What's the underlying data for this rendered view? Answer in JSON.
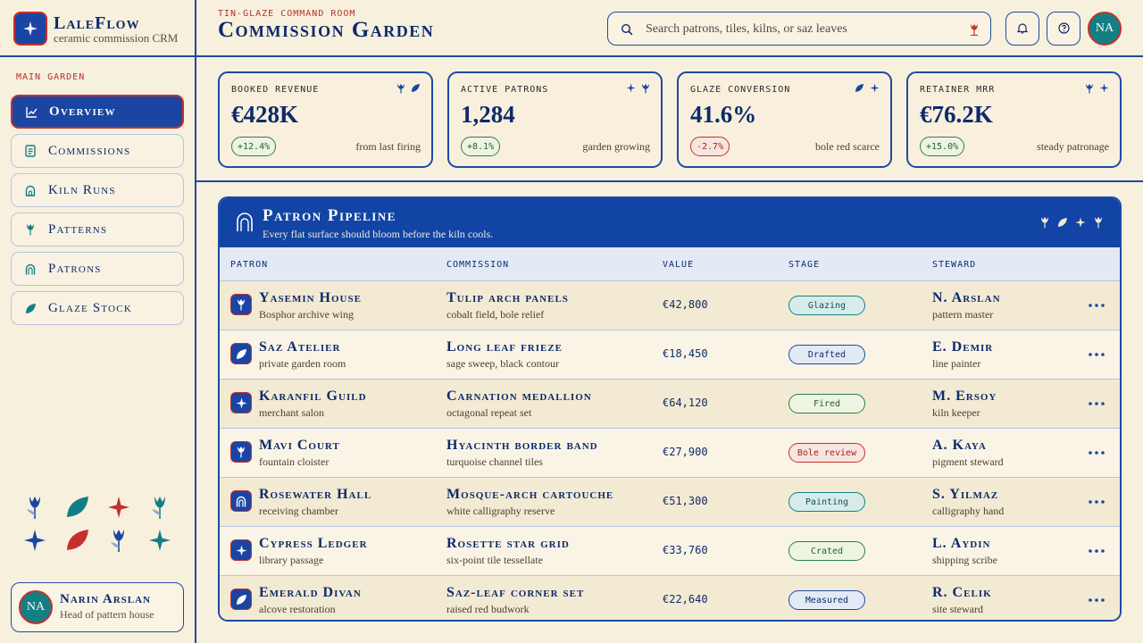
{
  "brand": {
    "name": "LaleFlow",
    "tagline": "ceramic commission CRM"
  },
  "sidebar": {
    "section_label": "MAIN GARDEN",
    "items": [
      {
        "label": "Overview",
        "icon": "chart-line-icon",
        "active": true
      },
      {
        "label": "Commissions",
        "icon": "document-icon",
        "active": false
      },
      {
        "label": "Kiln Runs",
        "icon": "kiln-icon",
        "active": false
      },
      {
        "label": "Patterns",
        "icon": "tulip-icon",
        "active": false
      },
      {
        "label": "Patrons",
        "icon": "arch-icon",
        "active": false
      },
      {
        "label": "Glaze Stock",
        "icon": "leaf-icon",
        "active": false
      }
    ],
    "user": {
      "initials": "NA",
      "name": "Narin Arslan",
      "role": "Head of pattern house"
    }
  },
  "header": {
    "eyebrow": "TIN-GLAZE COMMAND ROOM",
    "title": "Commission Garden",
    "search_placeholder": "Search patrons, tiles, kilns, or saz leaves",
    "avatar_initials": "NA"
  },
  "kpis": [
    {
      "label": "BOOKED REVENUE",
      "value": "€428K",
      "delta": "+12.4%",
      "direction": "up",
      "note": "from last firing"
    },
    {
      "label": "ACTIVE PATRONS",
      "value": "1,284",
      "delta": "+8.1%",
      "direction": "up",
      "note": "garden growing"
    },
    {
      "label": "GLAZE CONVERSION",
      "value": "41.6%",
      "delta": "-2.7%",
      "direction": "down",
      "note": "bole red scarce"
    },
    {
      "label": "RETAINER MRR",
      "value": "€76.2K",
      "delta": "+15.0%",
      "direction": "up",
      "note": "steady patronage"
    }
  ],
  "pipeline": {
    "title": "Patron Pipeline",
    "subtitle": "Every flat surface should bloom before the kiln cools.",
    "columns": {
      "patron": "PATRON",
      "commission": "COMMISSION",
      "value": "VALUE",
      "stage": "STAGE",
      "steward": "STEWARD"
    },
    "rows": [
      {
        "icon": "tulip-icon",
        "patron": "Yasemin House",
        "patron_note": "Bosphor archive wing",
        "commission": "Tulip arch panels",
        "commission_note": "cobalt field, bole relief",
        "value": "€42,800",
        "stage": "Glazing",
        "stage_kind": "teal",
        "steward": "N. Arslan",
        "steward_role": "pattern master"
      },
      {
        "icon": "leaf-icon",
        "patron": "Saz Atelier",
        "patron_note": "private garden room",
        "commission": "Long leaf frieze",
        "commission_note": "sage sweep, black contour",
        "value": "€18,450",
        "stage": "Drafted",
        "stage_kind": "blue",
        "steward": "E. Demir",
        "steward_role": "line painter"
      },
      {
        "icon": "star-icon",
        "patron": "Karanfil Guild",
        "patron_note": "merchant salon",
        "commission": "Carnation medallion",
        "commission_note": "octagonal repeat set",
        "value": "€64,120",
        "stage": "Fired",
        "stage_kind": "green",
        "steward": "M. Ersoy",
        "steward_role": "kiln keeper"
      },
      {
        "icon": "tulip-icon",
        "patron": "Mavi Court",
        "patron_note": "fountain cloister",
        "commission": "Hyacinth border band",
        "commission_note": "turquoise channel tiles",
        "value": "€27,900",
        "stage": "Bole review",
        "stage_kind": "red",
        "steward": "A. Kaya",
        "steward_role": "pigment steward"
      },
      {
        "icon": "arch-icon",
        "patron": "Rosewater Hall",
        "patron_note": "receiving chamber",
        "commission": "Mosque-arch cartouche",
        "commission_note": "white calligraphy reserve",
        "value": "€51,300",
        "stage": "Painting",
        "stage_kind": "teal",
        "steward": "S. Yilmaz",
        "steward_role": "calligraphy hand"
      },
      {
        "icon": "star-icon",
        "patron": "Cypress Ledger",
        "patron_note": "library passage",
        "commission": "Rosette star grid",
        "commission_note": "six-point tile tessellate",
        "value": "€33,760",
        "stage": "Crated",
        "stage_kind": "green",
        "steward": "L. Aydin",
        "steward_role": "shipping scribe"
      },
      {
        "icon": "leaf-icon",
        "patron": "Emerald Divan",
        "patron_note": "alcove restoration",
        "commission": "Saz-leaf corner set",
        "commission_note": "raised red budwork",
        "value": "€22,640",
        "stage": "Measured",
        "stage_kind": "blue",
        "steward": "R. Celik",
        "steward_role": "site steward"
      }
    ]
  },
  "colors": {
    "cobalt": "#1144a4",
    "bole_red": "#c4302e",
    "turquoise": "#137f84",
    "cream": "#f7f0dd",
    "navy_text": "#0d2a6b"
  }
}
